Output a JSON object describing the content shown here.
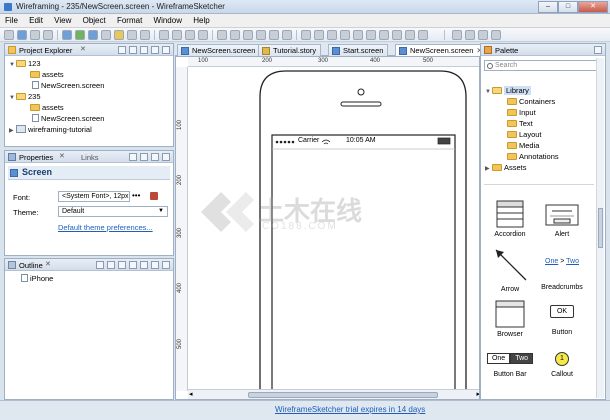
{
  "window": {
    "title": "Wireframing - 235/NewScreen.screen - WireframeSketcher"
  },
  "menu": [
    "File",
    "Edit",
    "View",
    "Object",
    "Format",
    "Window",
    "Help"
  ],
  "project_explorer": {
    "title": "Project Explorer",
    "items": [
      {
        "label": "123"
      },
      {
        "label": "assets"
      },
      {
        "label": "NewScreen.screen"
      },
      {
        "label": "235"
      },
      {
        "label": "assets"
      },
      {
        "label": "NewScreen.screen"
      },
      {
        "label": "wireframing-tutorial"
      }
    ]
  },
  "properties": {
    "title": "Properties",
    "links_tab": "Links",
    "heading": "Screen",
    "font_label": "Font:",
    "font_value": "<System Font>, 12px",
    "theme_label": "Theme:",
    "theme_value": "Default",
    "theme_link": "Default theme preferences..."
  },
  "outline": {
    "title": "Outline",
    "item": "iPhone"
  },
  "tabs": [
    "NewScreen.screen",
    "Tutorial.story",
    "Start.screen",
    "NewScreen.screen"
  ],
  "ruler": {
    "h": [
      "100",
      "200",
      "300",
      "400",
      "500"
    ],
    "v": [
      "100",
      "200",
      "300",
      "400",
      "500"
    ]
  },
  "phone": {
    "carrier": "Carrier",
    "time": "10:05 AM"
  },
  "watermark": {
    "text": "土木在线",
    "subtext": "CO188.COM"
  },
  "palette": {
    "title": "Palette",
    "search_placeholder": "Search",
    "tree": [
      "Library",
      "Containers",
      "Input",
      "Text",
      "Layout",
      "Media",
      "Annotations",
      "Assets"
    ],
    "items": [
      {
        "label": "Accordion"
      },
      {
        "label": "Alert"
      },
      {
        "label": "Arrow"
      },
      {
        "label": "Breadcrumbs",
        "crumb1": "One",
        "crumb_sep": ">",
        "crumb2": "Two"
      },
      {
        "label": "Browser"
      },
      {
        "label": "Button",
        "preview": "OK"
      },
      {
        "label": "Button Bar",
        "preview1": "One",
        "preview2": "Two"
      },
      {
        "label": "Callout",
        "preview": "1"
      }
    ]
  },
  "status": {
    "trial": "WireframeSketcher trial expires in 14 days"
  }
}
